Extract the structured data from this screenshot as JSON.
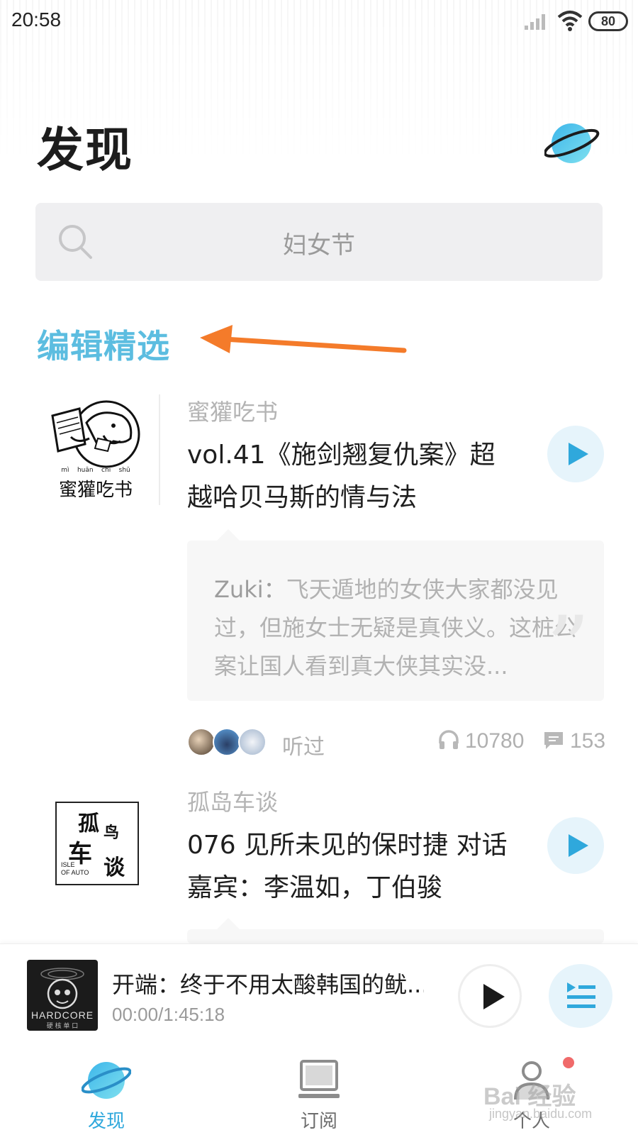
{
  "status_bar": {
    "time": "20:58",
    "battery": "80"
  },
  "header": {
    "title": "发现"
  },
  "search": {
    "placeholder": "妇女节"
  },
  "section": {
    "title": "编辑精选"
  },
  "cards": [
    {
      "cover_text": "蜜獾吃书",
      "cover_pinyin": [
        "mì",
        "huān",
        "chī",
        "shū"
      ],
      "channel": "蜜獾吃书",
      "title": "vol.41《施剑翘复仇案》超越哈贝马斯的情与法",
      "comment_user": "Zuki：",
      "comment_text": "飞天遁地的女侠大家都没见过，但施女士无疑是真侠义。这桩公案让国人看到真大侠其实没...",
      "listened_label": "听过",
      "listen_count": "10780",
      "comment_count": "153"
    },
    {
      "cover_text": [
        "孤",
        "鸟",
        "车",
        "谈"
      ],
      "cover_en": [
        "ISLE",
        "OF AUTO"
      ],
      "channel": "孤岛车谈",
      "title": "076 见所未见的保时捷 对话嘉宾：李温如，丁伯骏"
    }
  ],
  "mini_player": {
    "title": "开端：终于不用太酸韩国的鱿...",
    "time": "00:00/1:45:18",
    "cover_text": "HARDCORE",
    "cover_subtext": "硬 核 单 口"
  },
  "tabs": [
    {
      "label": "发现",
      "active": true
    },
    {
      "label": "订阅",
      "active": false
    },
    {
      "label": "个人",
      "active": false
    }
  ],
  "watermark": {
    "brand": "Bai 经验",
    "url": "jingyan.baidu.com"
  },
  "colors": {
    "accent": "#2fa8dc",
    "section_title": "#5cbde0",
    "annotation_arrow": "#f47b2a"
  }
}
